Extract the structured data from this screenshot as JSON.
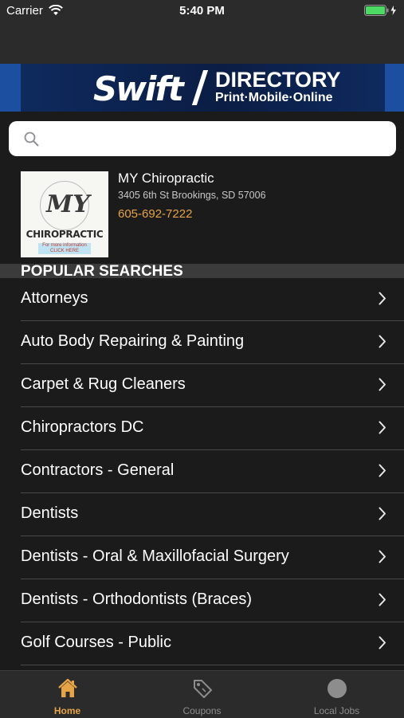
{
  "status_bar": {
    "carrier": "Carrier",
    "time": "5:40 PM"
  },
  "banner": {
    "brand_left": "Swift",
    "brand_right": "DIRECTORY",
    "tagline": "Print·Mobile·Online",
    "colors": {
      "background": "#0d2250",
      "accent": "#1d4fa0"
    }
  },
  "search": {
    "placeholder": "",
    "value": ""
  },
  "featured": {
    "ad": {
      "headline": "MY",
      "title": "CHIROPRACTIC",
      "cta": "For more information CLICK HERE"
    },
    "name": "MY Chiropractic",
    "address": "3405 6th St Brookings, SD 57006",
    "phone": "605-692-7222"
  },
  "popular": {
    "title": "POPULAR SEARCHES",
    "items": [
      {
        "label": "Attorneys"
      },
      {
        "label": "Auto Body Repairing & Painting"
      },
      {
        "label": "Carpet & Rug Cleaners"
      },
      {
        "label": "Chiropractors DC"
      },
      {
        "label": "Contractors - General"
      },
      {
        "label": "Dentists"
      },
      {
        "label": "Dentists - Oral & Maxillofacial Surgery"
      },
      {
        "label": "Dentists - Orthodontists (Braces)"
      },
      {
        "label": "Golf Courses - Public"
      }
    ]
  },
  "tabbar": {
    "tabs": [
      {
        "label": "Home",
        "icon": "home-icon",
        "active": true
      },
      {
        "label": "Coupons",
        "icon": "tag-icon",
        "active": false
      },
      {
        "label": "Local Jobs",
        "icon": "circle-icon",
        "active": false
      }
    ],
    "colors": {
      "active": "#e6a446",
      "inactive": "#8d8d8d"
    }
  }
}
